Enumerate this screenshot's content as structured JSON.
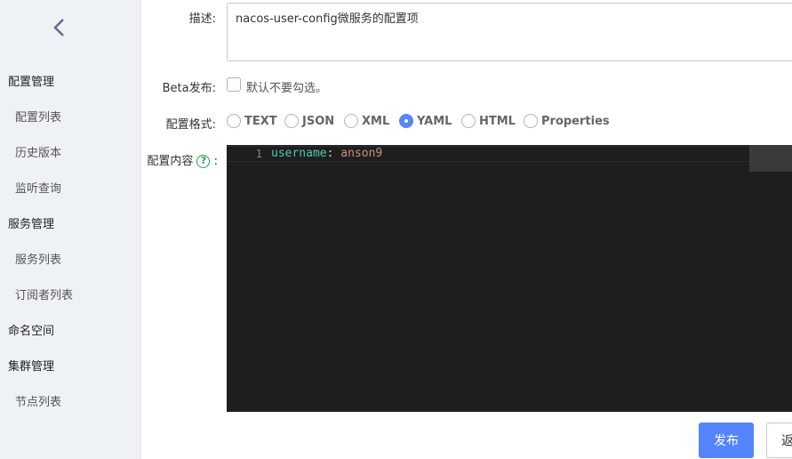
{
  "sidebar": {
    "collapse_icon": "chevron-left-icon",
    "items": [
      {
        "label": "配置管理",
        "type": "group"
      },
      {
        "label": "配置列表",
        "type": "sub"
      },
      {
        "label": "历史版本",
        "type": "sub"
      },
      {
        "label": "监听查询",
        "type": "sub"
      },
      {
        "label": "服务管理",
        "type": "group"
      },
      {
        "label": "服务列表",
        "type": "sub"
      },
      {
        "label": "订阅者列表",
        "type": "sub"
      },
      {
        "label": "命名空间",
        "type": "group"
      },
      {
        "label": "集群管理",
        "type": "group"
      },
      {
        "label": "节点列表",
        "type": "sub"
      }
    ]
  },
  "form": {
    "description_label": "描述:",
    "description_value": "nacos-user-config微服务的配置项",
    "beta_label": "Beta发布:",
    "beta_checkbox_text": "默认不要勾选。",
    "format_label": "配置格式:",
    "formats": [
      "TEXT",
      "JSON",
      "XML",
      "YAML",
      "HTML",
      "Properties"
    ],
    "selected_format": "YAML",
    "content_label": "配置内容",
    "content_colon": ":",
    "help_icon_char": "?"
  },
  "editor": {
    "line_number": "1",
    "key": "username",
    "separator": ": ",
    "value": "anson9"
  },
  "actions": {
    "publish_label": "发布",
    "back_label": "返回"
  },
  "colors": {
    "accent": "#5584ff",
    "sidebar_bg": "#eef1f6",
    "editor_bg": "#1e1e1e"
  }
}
